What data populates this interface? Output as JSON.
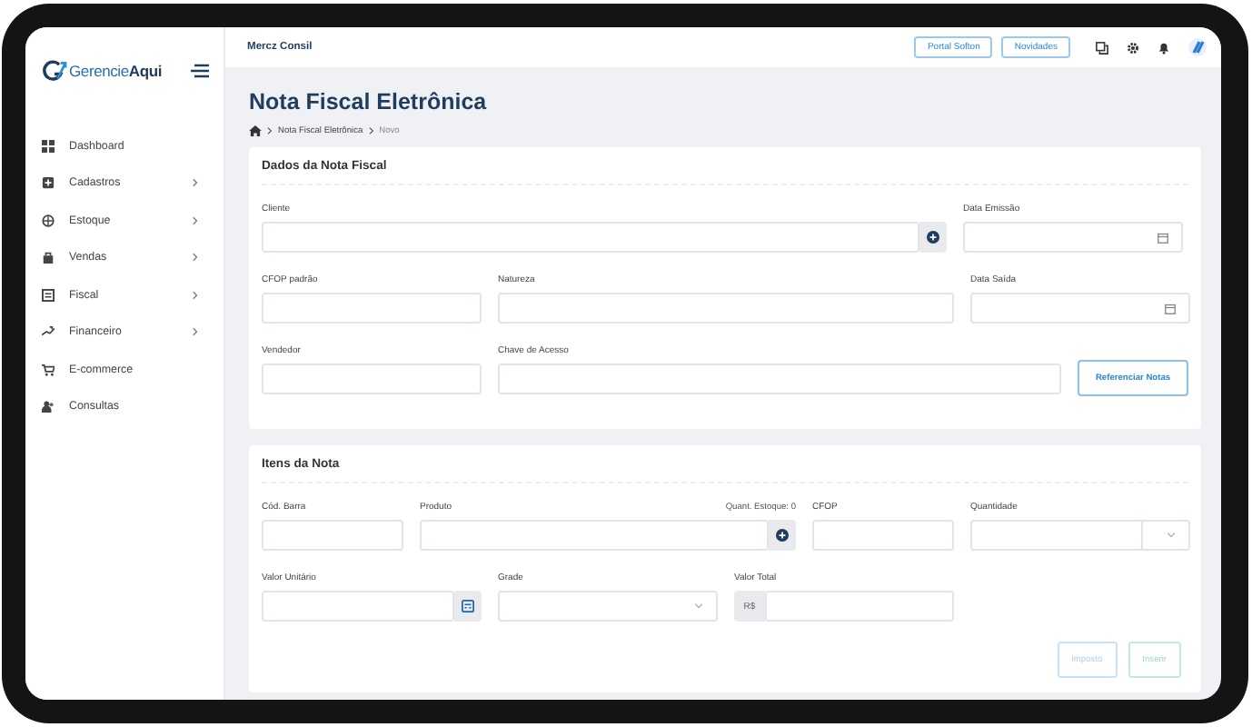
{
  "logo": {
    "text": "Gerencie**Aqui**"
  },
  "header": {
    "company": "Mercz Consil",
    "buttons": [
      {
        "label": "Portal Softon"
      },
      {
        "label": "Novidades"
      }
    ]
  },
  "sidebar": {
    "items": [
      {
        "label": "Dashboard",
        "expandable": false
      },
      {
        "label": "Cadastros",
        "expandable": true
      },
      {
        "label": "Estoque",
        "expandable": true
      },
      {
        "label": "Vendas",
        "expandable": true
      },
      {
        "label": "Fiscal",
        "expandable": true
      },
      {
        "label": "Financeiro",
        "expandable": true
      },
      {
        "label": "E-commerce",
        "expandable": false
      },
      {
        "label": "Consultas",
        "expandable": false
      }
    ]
  },
  "page": {
    "title": "Nota Fiscal Eletrônica",
    "breadcrumb": [
      {
        "label": "Nota Fiscal Eletrônica",
        "current": false
      },
      {
        "label": "Novo",
        "current": true
      }
    ]
  },
  "sections": [
    {
      "title": "Dados da Nota Fiscal",
      "fields": [
        {
          "kind": "search",
          "label": "Cliente"
        },
        {
          "kind": "date",
          "label": "Data Emissão"
        },
        {
          "kind": "text",
          "label": "CFOP padrão"
        },
        {
          "kind": "text",
          "label": "Natureza"
        },
        {
          "kind": "date",
          "label": "Data Saída"
        },
        {
          "kind": "text",
          "label": "Vendedor"
        },
        {
          "kind": "text",
          "label": "Chave de Acesso"
        },
        {
          "kind": "button",
          "label": "Referenciar Notas",
          "disabled": false
        }
      ]
    },
    {
      "title": "Itens da Nota",
      "fields": [
        {
          "kind": "text",
          "label": "Cód. Barra"
        },
        {
          "kind": "search",
          "label": "Produto",
          "hint": "Quant. Estoque: 0"
        },
        {
          "kind": "text",
          "label": "CFOP"
        },
        {
          "kind": "select",
          "label": "Quantidade"
        },
        {
          "kind": "calculator",
          "label": "Valor Unitário"
        },
        {
          "kind": "select",
          "label": "Grade"
        },
        {
          "kind": "currency",
          "label": "Valor Total",
          "prefix": "R$"
        }
      ],
      "actions": [
        {
          "label": "Imposto",
          "kind": "primary",
          "disabled": true
        },
        {
          "label": "Inserir",
          "kind": "success",
          "disabled": true
        }
      ]
    }
  ]
}
